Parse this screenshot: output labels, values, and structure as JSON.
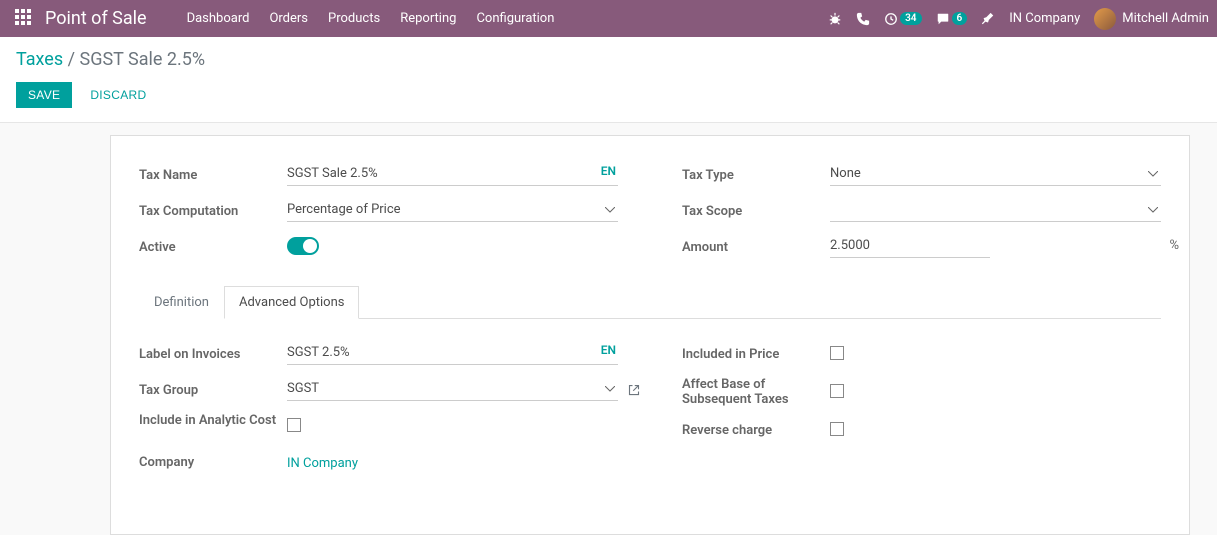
{
  "nav": {
    "app_title": "Point of Sale",
    "items": [
      "Dashboard",
      "Orders",
      "Products",
      "Reporting",
      "Configuration"
    ],
    "timer_badge": "34",
    "chat_badge": "6",
    "company": "IN Company",
    "user": "Mitchell Admin"
  },
  "breadcrumb": {
    "root": "Taxes",
    "sep": "/",
    "current": "SGST Sale 2.5%"
  },
  "buttons": {
    "save": "SAVE",
    "discard": "DISCARD"
  },
  "form": {
    "labels": {
      "tax_name": "Tax Name",
      "tax_computation": "Tax Computation",
      "active": "Active",
      "tax_type": "Tax Type",
      "tax_scope": "Tax Scope",
      "amount": "Amount",
      "amount_suffix": "%",
      "label_on_invoices": "Label on Invoices",
      "tax_group": "Tax Group",
      "include_in_analytic": "Include in Analytic Cost",
      "company": "Company",
      "included_in_price": "Included in Price",
      "affect_base": "Affect Base of Subsequent Taxes",
      "reverse_charge": "Reverse charge"
    },
    "values": {
      "tax_name": "SGST Sale 2.5%",
      "tax_computation": "Percentage of Price",
      "active": true,
      "tax_type": "None",
      "tax_scope": "",
      "amount": "2.5000",
      "label_on_invoices": "SGST 2.5%",
      "tax_group": "SGST",
      "include_in_analytic": false,
      "company": "IN Company",
      "included_in_price": false,
      "affect_base": false,
      "reverse_charge": false
    },
    "lang_tag": "EN"
  },
  "tabs": {
    "definition": "Definition",
    "advanced": "Advanced Options",
    "active": "advanced"
  }
}
